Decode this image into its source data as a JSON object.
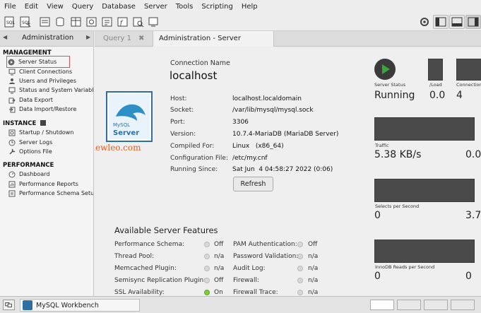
{
  "menu": [
    "File",
    "Edit",
    "View",
    "Query",
    "Database",
    "Server",
    "Tools",
    "Scripting",
    "Help"
  ],
  "sidebar": {
    "header": "Administration",
    "sections": [
      {
        "title": "MANAGEMENT",
        "items": [
          "Server Status",
          "Client Connections",
          "Users and Privileges",
          "Status and System Variables",
          "Data Export",
          "Data Import/Restore"
        ]
      },
      {
        "title": "INSTANCE",
        "items": [
          "Startup / Shutdown",
          "Server Logs",
          "Options File"
        ]
      },
      {
        "title": "PERFORMANCE",
        "items": [
          "Dashboard",
          "Performance Reports",
          "Performance Schema Setup"
        ]
      }
    ]
  },
  "tabs": [
    {
      "label": "Query 1",
      "close": "✖"
    },
    {
      "label": "Administration - Server Status",
      "close": "✖"
    }
  ],
  "connection": {
    "caption": "Connection Name",
    "name": "localhost",
    "logo_text_top": "MySQL",
    "logo_text_bottom": "Server",
    "fields": [
      {
        "label": "Host:",
        "value": "localhost.localdomain"
      },
      {
        "label": "Socket:",
        "value": "/var/lib/mysql/mysql.sock"
      },
      {
        "label": "Port:",
        "value": "3306"
      },
      {
        "label": "Version:",
        "value": "10.7.4-MariaDB (MariaDB Server)"
      },
      {
        "label": "Compiled For:",
        "value": "Linux   (x86_64)"
      },
      {
        "label": "Configuration File:",
        "value": "/etc/my.cnf"
      },
      {
        "label": "Running Since:",
        "value": "Sat Jun  4 04:58:27 2022 (0:06)"
      }
    ],
    "refresh_button": "Refresh"
  },
  "watermark": "techviewleo.com",
  "features": {
    "title": "Available Server Features",
    "left": [
      {
        "label": "Performance Schema:",
        "value": "Off",
        "on": false
      },
      {
        "label": "Thread Pool:",
        "value": "n/a",
        "on": false
      },
      {
        "label": "Memcached Plugin:",
        "value": "n/a",
        "on": false
      },
      {
        "label": "Semisync Replication Plugin:",
        "value": "Off",
        "on": false
      },
      {
        "label": "SSL Availability:",
        "value": "On",
        "on": true
      }
    ],
    "right": [
      {
        "label": "PAM Authentication:",
        "value": "Off",
        "on": false
      },
      {
        "label": "Password Validation:",
        "value": "n/a",
        "on": false
      },
      {
        "label": "Audit Log:",
        "value": "n/a",
        "on": false
      },
      {
        "label": "Firewall:",
        "value": "n/a",
        "on": false
      },
      {
        "label": "Firewall Trace:",
        "value": "n/a",
        "on": false
      }
    ]
  },
  "status": {
    "server_status_label": "Server Status",
    "server_status_value": "Running",
    "load_label": "/Load",
    "load_value": "0.0",
    "connections_label": "Connection",
    "connections_value": "4",
    "traffic_label": "Traffic",
    "traffic_value": "5.38 KB/s",
    "traffic_right": "0.0",
    "selects_label": "Selects per Second",
    "selects_value": "0",
    "selects_right": "3.7",
    "innodb_label": "InnoDB Reads per Second",
    "innodb_value": "0",
    "innodb_right": "0"
  },
  "taskbar": {
    "app": "MySQL Workbench"
  },
  "colors": {
    "accent_green": "#3aa53a",
    "graph_bg": "#4a4a4a",
    "selection_outline": "#e05050"
  }
}
